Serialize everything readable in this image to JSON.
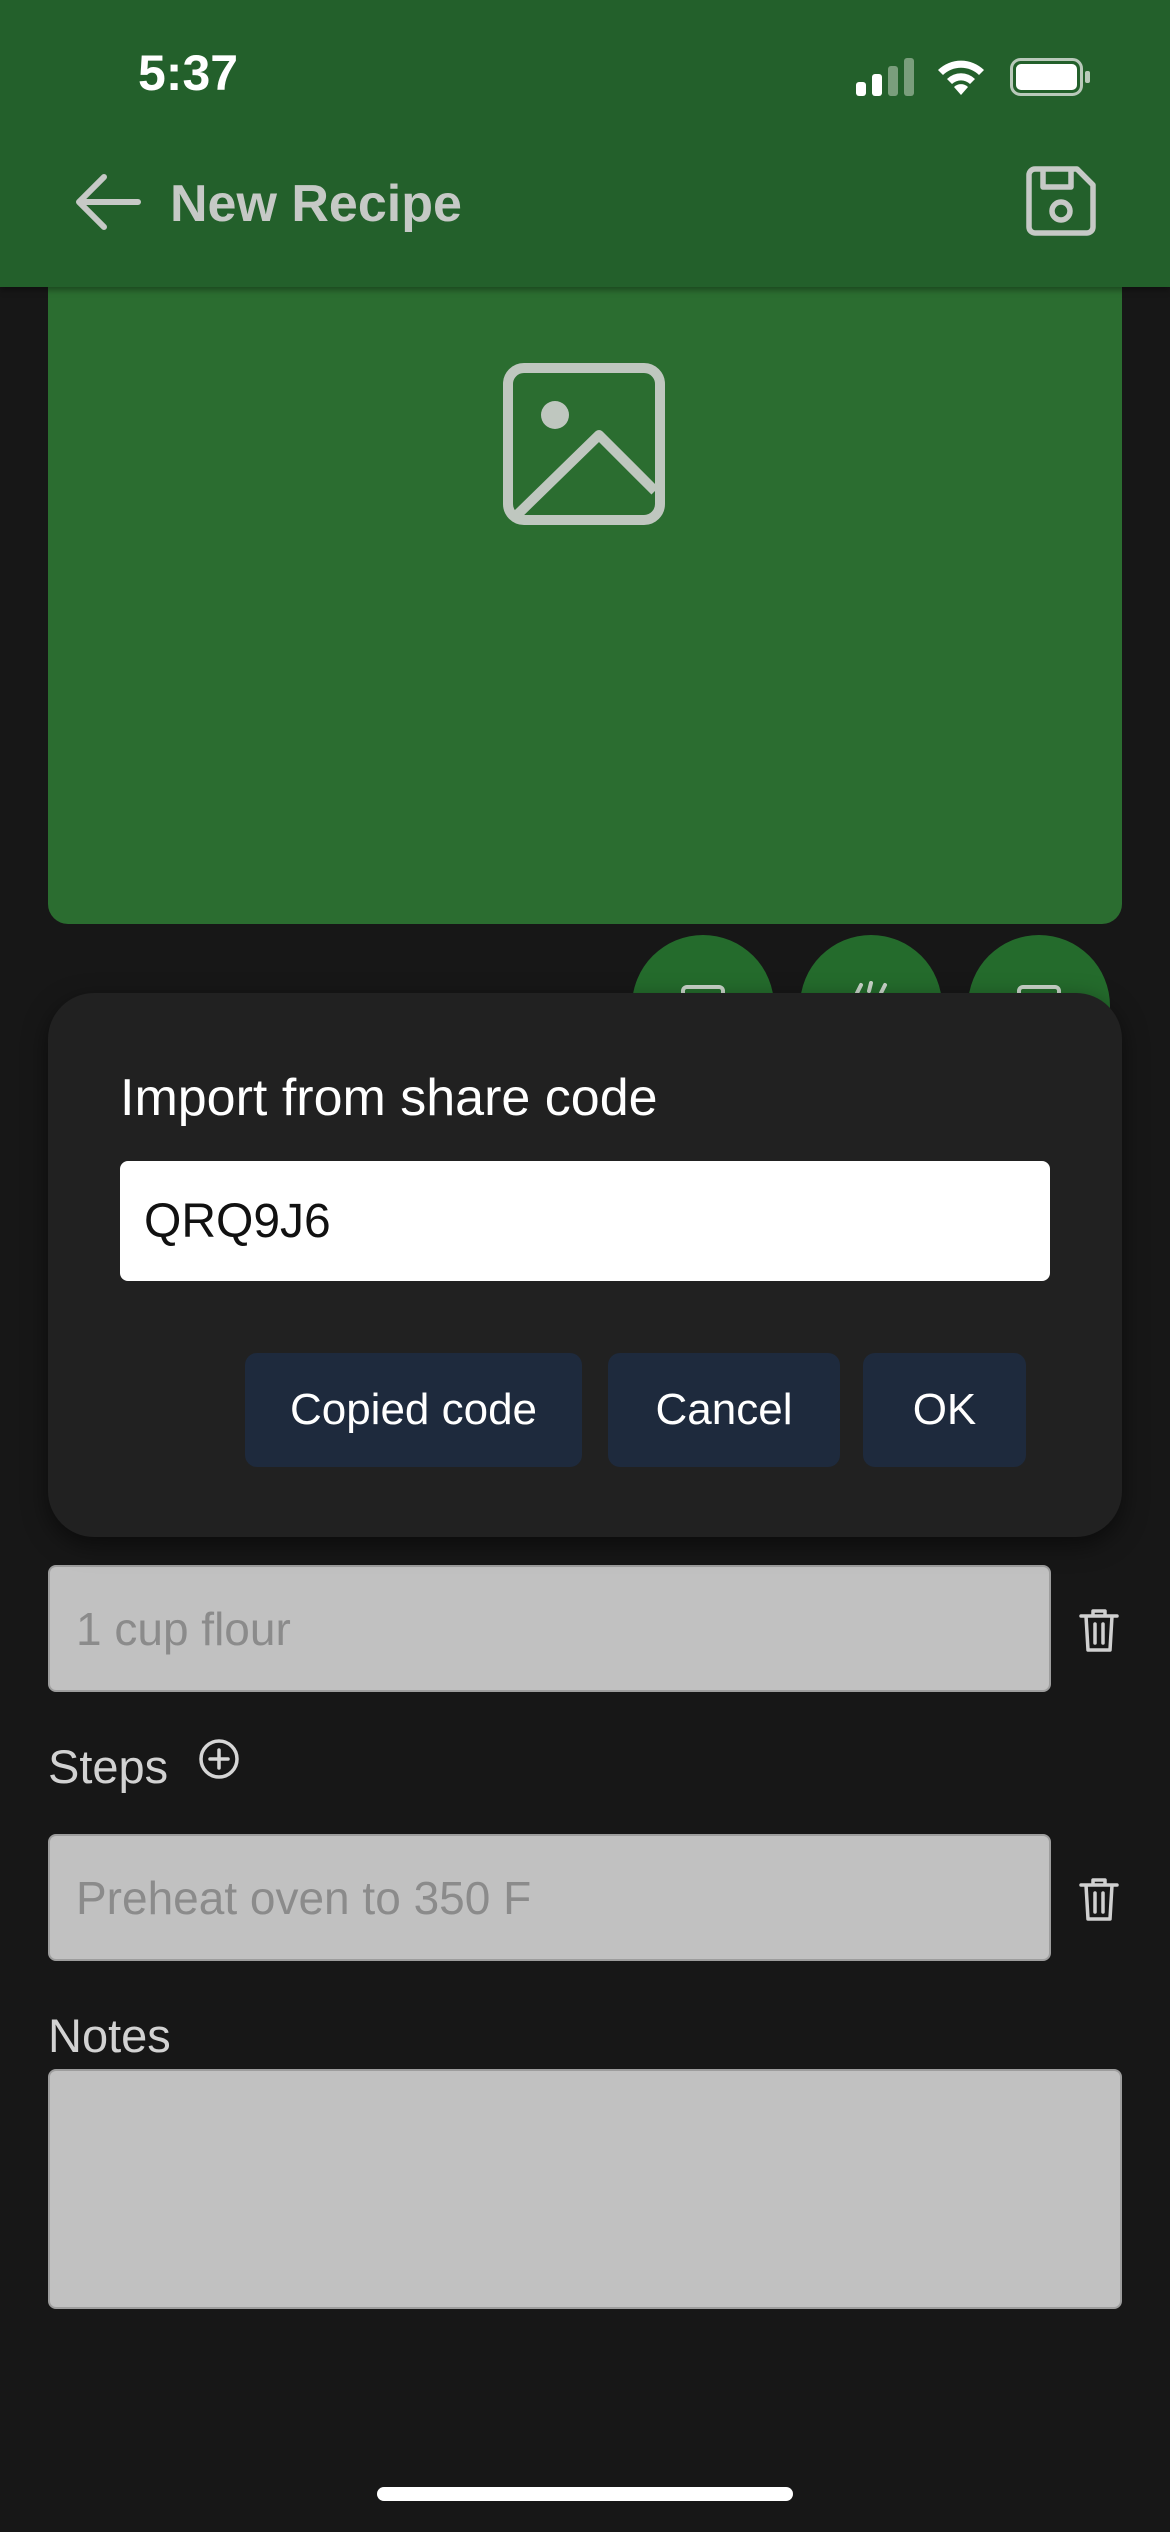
{
  "status_bar": {
    "time": "5:37",
    "signal_icon": "cellular-signal-icon",
    "wifi_icon": "wifi-icon",
    "battery_icon": "battery-icon"
  },
  "header": {
    "title": "New Recipe",
    "back_icon": "arrow-left-icon",
    "save_icon": "save-icon",
    "background_color": "#23602b"
  },
  "recipe_image": {
    "icon": "image-placeholder-icon",
    "background_color": "#2b6d30"
  },
  "image_actions": [
    {
      "icon": "camera-icon"
    },
    {
      "icon": "wand-icon"
    },
    {
      "icon": "gallery-icon"
    }
  ],
  "dialog": {
    "title": "Import from share code",
    "input_value": "QRQ9J6",
    "buttons": {
      "copied_code": "Copied code",
      "cancel": "Cancel",
      "ok": "OK"
    },
    "button_color": "#1e2a3d"
  },
  "ingredients": {
    "items": [
      {
        "placeholder": "1 cup flour"
      }
    ]
  },
  "steps": {
    "label": "Steps",
    "add_icon": "add-circle-icon",
    "items": [
      {
        "placeholder": "Preheat oven to 350 F"
      }
    ]
  },
  "notes": {
    "label": "Notes",
    "value": ""
  }
}
